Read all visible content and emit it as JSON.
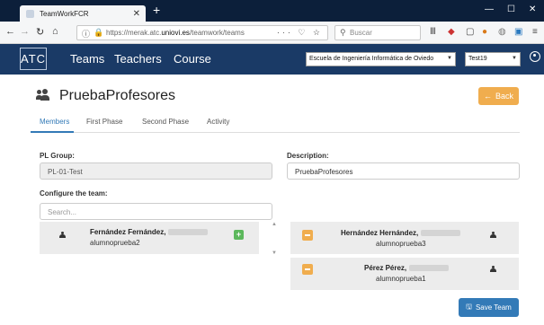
{
  "browser": {
    "tab_title": "TeamWorkFCR",
    "url_prefix": "https://merak.atc.",
    "url_domain": "uniovi.es",
    "url_path": "/teamwork/teams",
    "search_placeholder": "Buscar"
  },
  "app": {
    "logo_text": "ATC",
    "nav": [
      "Teams",
      "Teachers",
      "Course"
    ],
    "school_select": "Escuela de Ingeniería Informática de Oviedo",
    "user_select": "Test19"
  },
  "page": {
    "title": "PruebaProfesores",
    "back_label": "Back",
    "tabs": [
      "Members",
      "First Phase",
      "Second Phase",
      "Activity"
    ],
    "active_tab": "Members"
  },
  "form": {
    "pl_group_label": "PL Group:",
    "pl_group_value": "PL-01-Test",
    "description_label": "Description:",
    "description_value": "PruebaProfesores",
    "configure_label": "Configure the team:",
    "search_placeholder": "Search..."
  },
  "available_members": [
    {
      "name": "Fernández Fernández,",
      "username": "alumnoprueba2"
    }
  ],
  "team_members": [
    {
      "name": "Hernández Hernández,",
      "username": "alumnoprueba3"
    },
    {
      "name": "Pérez Pérez,",
      "username": "alumnoprueba1"
    }
  ],
  "save_label": "Save Team",
  "colors": {
    "appbar": "#1a3a66",
    "primary": "#337ab7",
    "warning": "#f0ad4e",
    "success": "#5cb85c"
  }
}
